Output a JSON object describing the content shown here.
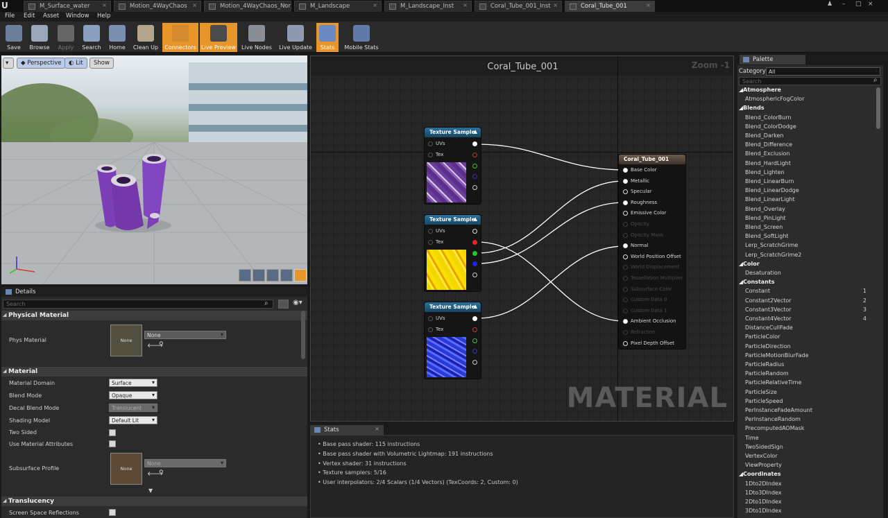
{
  "tabs": [
    "M_Surface_water",
    "Motion_4WayChaos",
    "Motion_4WayChaos_Norm",
    "M_Landscape",
    "M_Landscape_Inst",
    "Coral_Tube_001_Inst",
    "Coral_Tube_001"
  ],
  "menu": [
    "File",
    "Edit",
    "Asset",
    "Window",
    "Help"
  ],
  "toolbar": [
    {
      "label": "Save",
      "icon": "save-icon"
    },
    {
      "label": "Browse",
      "icon": "browse-icon"
    },
    {
      "label": "Apply",
      "icon": "apply-icon"
    },
    {
      "label": "Search",
      "icon": "search-icon"
    },
    {
      "label": "Home",
      "icon": "home-icon"
    },
    {
      "label": "Clean Up",
      "icon": "clean-up-icon"
    },
    {
      "label": "Connectors",
      "icon": "connectors-icon"
    },
    {
      "label": "Live Preview",
      "icon": "live-preview-icon"
    },
    {
      "label": "Live Nodes",
      "icon": "live-nodes-icon"
    },
    {
      "label": "Live Update",
      "icon": "live-update-icon"
    },
    {
      "label": "Stats",
      "icon": "stats-icon"
    },
    {
      "label": "Mobile Stats",
      "icon": "mobile-stats-icon"
    }
  ],
  "viewport": {
    "perspective": "Perspective",
    "lit": "Lit",
    "show": "Show"
  },
  "details": {
    "tab": "Details",
    "search_placeholder": "Search",
    "physical_material": "Physical Material",
    "phys_material_label": "Phys Material",
    "phys_material_value": "None",
    "thumb_none": "None",
    "material": "Material",
    "material_domain_label": "Material Domain",
    "material_domain": "Surface",
    "blend_mode_label": "Blend Mode",
    "blend_mode": "Opaque",
    "decal_blend_label": "Decal Blend Mode",
    "decal_blend": "Translucent",
    "shading_model_label": "Shading Model",
    "shading_model": "Default Lit",
    "two_sided_label": "Two Sided",
    "use_attr_label": "Use Material Attributes",
    "subsurface_label": "Subsurface Profile",
    "subsurface_value": "None",
    "translucency": "Translucency",
    "ssr_label": "Screen Space Reflections"
  },
  "graph": {
    "title": "Coral_Tube_001",
    "zoom": "Zoom -1",
    "watermark": "MATERIAL",
    "texture_node_title": "Texture Sample",
    "uvs": "UVs",
    "tex": "Tex",
    "result_title": "Coral_Tube_001",
    "result_pins": [
      {
        "label": "Base Color",
        "active": true
      },
      {
        "label": "Metallic",
        "active": true
      },
      {
        "label": "Specular",
        "active": true
      },
      {
        "label": "Roughness",
        "active": true
      },
      {
        "label": "Emissive Color",
        "active": true
      },
      {
        "label": "Opacity",
        "active": false
      },
      {
        "label": "Opacity Mask",
        "active": false
      },
      {
        "label": "Normal",
        "active": true
      },
      {
        "label": "World Position Offset",
        "active": true
      },
      {
        "label": "World Displacement",
        "active": false
      },
      {
        "label": "Tessellation Multiplier",
        "active": false
      },
      {
        "label": "Subsurface Color",
        "active": false
      },
      {
        "label": "Custom Data 0",
        "active": false
      },
      {
        "label": "Custom Data 1",
        "active": false
      },
      {
        "label": "Ambient Occlusion",
        "active": true
      },
      {
        "label": "Refraction",
        "active": false
      },
      {
        "label": "Pixel Depth Offset",
        "active": true
      }
    ]
  },
  "stats": {
    "tab": "Stats",
    "lines": [
      "Base pass shader: 115 instructions",
      "Base pass shader with Volumetric Lightmap: 191 instructions",
      "Vertex shader: 31 instructions",
      "Texture samplers: 5/16",
      "User interpolators: 2/4 Scalars (1/4 Vectors) (TexCoords: 2, Custom: 0)"
    ]
  },
  "palette": {
    "tab": "Palette",
    "category_label": "Category:",
    "category_value": "All",
    "search_placeholder": "Search",
    "rows": [
      {
        "t": "cat",
        "label": "Atmosphere"
      },
      {
        "t": "item",
        "label": "AtmosphericFogColor"
      },
      {
        "t": "cat",
        "label": "Blends"
      },
      {
        "t": "item",
        "label": "Blend_ColorBurn"
      },
      {
        "t": "item",
        "label": "Blend_ColorDodge"
      },
      {
        "t": "item",
        "label": "Blend_Darken"
      },
      {
        "t": "item",
        "label": "Blend_Difference"
      },
      {
        "t": "item",
        "label": "Blend_Exclusion"
      },
      {
        "t": "item",
        "label": "Blend_HardLight"
      },
      {
        "t": "item",
        "label": "Blend_Lighten"
      },
      {
        "t": "item",
        "label": "Blend_LinearBurn"
      },
      {
        "t": "item",
        "label": "Blend_LinearDodge"
      },
      {
        "t": "item",
        "label": "Blend_LinearLight"
      },
      {
        "t": "item",
        "label": "Blend_Overlay"
      },
      {
        "t": "item",
        "label": "Blend_PinLight"
      },
      {
        "t": "item",
        "label": "Blend_Screen"
      },
      {
        "t": "item",
        "label": "Blend_SoftLight"
      },
      {
        "t": "item",
        "label": "Lerp_ScratchGrime"
      },
      {
        "t": "item",
        "label": "Lerp_ScratchGrime2"
      },
      {
        "t": "cat",
        "label": "Color"
      },
      {
        "t": "item",
        "label": "Desaturation"
      },
      {
        "t": "cat",
        "label": "Constants"
      },
      {
        "t": "item",
        "label": "Constant",
        "num": "1"
      },
      {
        "t": "item",
        "label": "Constant2Vector",
        "num": "2"
      },
      {
        "t": "item",
        "label": "Constant3Vector",
        "num": "3"
      },
      {
        "t": "item",
        "label": "Constant4Vector",
        "num": "4"
      },
      {
        "t": "item",
        "label": "DistanceCullFade"
      },
      {
        "t": "item",
        "label": "ParticleColor"
      },
      {
        "t": "item",
        "label": "ParticleDirection"
      },
      {
        "t": "item",
        "label": "ParticleMotionBlurFade"
      },
      {
        "t": "item",
        "label": "ParticleRadius"
      },
      {
        "t": "item",
        "label": "ParticleRandom"
      },
      {
        "t": "item",
        "label": "ParticleRelativeTime"
      },
      {
        "t": "item",
        "label": "ParticleSize"
      },
      {
        "t": "item",
        "label": "ParticleSpeed"
      },
      {
        "t": "item",
        "label": "PerInstanceFadeAmount"
      },
      {
        "t": "item",
        "label": "PerInstanceRandom"
      },
      {
        "t": "item",
        "label": "PrecomputedAOMask"
      },
      {
        "t": "item",
        "label": "Time"
      },
      {
        "t": "item",
        "label": "TwoSidedSign"
      },
      {
        "t": "item",
        "label": "VertexColor"
      },
      {
        "t": "item",
        "label": "ViewProperty"
      },
      {
        "t": "cat",
        "label": "Coordinates"
      },
      {
        "t": "item",
        "label": "1Dto2DIndex"
      },
      {
        "t": "item",
        "label": "1Dto3DIndex"
      },
      {
        "t": "item",
        "label": "2Dto1DIndex"
      },
      {
        "t": "item",
        "label": "3Dto1DIndex"
      }
    ]
  }
}
